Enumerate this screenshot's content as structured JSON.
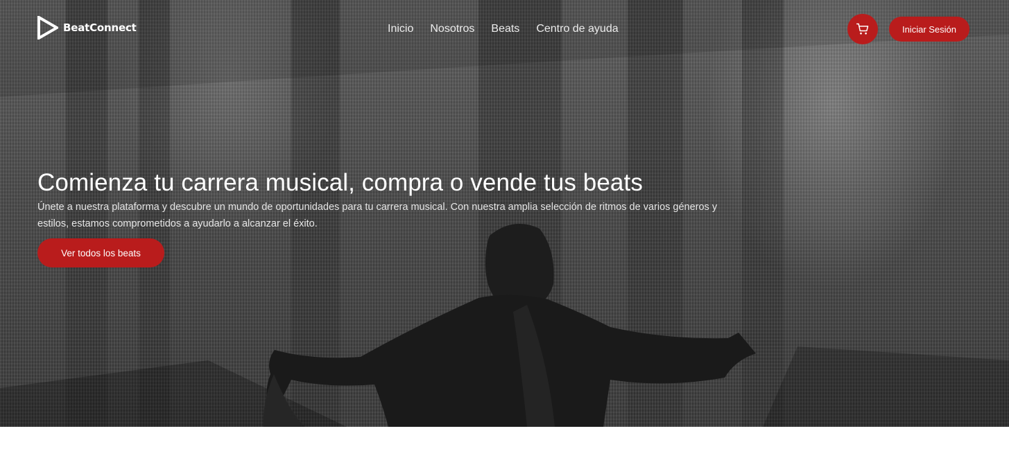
{
  "brand": {
    "name": "BeatConnect",
    "icon": "play-triangle-logo"
  },
  "nav": {
    "items": [
      {
        "label": "Inicio"
      },
      {
        "label": "Nosotros"
      },
      {
        "label": "Beats"
      },
      {
        "label": "Centro de ayuda"
      }
    ]
  },
  "header": {
    "cart_icon": "cart-icon",
    "login_label": "Iniciar Sesión"
  },
  "hero": {
    "title": "Comienza tu carrera musical, compra o vende tus beats",
    "description": "Únete a nuestra plataforma y descubre un mundo de oportunidades para tu carrera musical. Con nuestra amplia selección de ritmos de varios géneros y estilos, estamos comprometidos a ayudarlo a alcanzar el éxito.",
    "cta_label": "Ver todos los beats",
    "background": "grayscale photo of a person with outstretched arms"
  },
  "colors": {
    "accent": "#b91c1c",
    "hero_text": "#ffffff",
    "page_background": "#ffffff"
  }
}
